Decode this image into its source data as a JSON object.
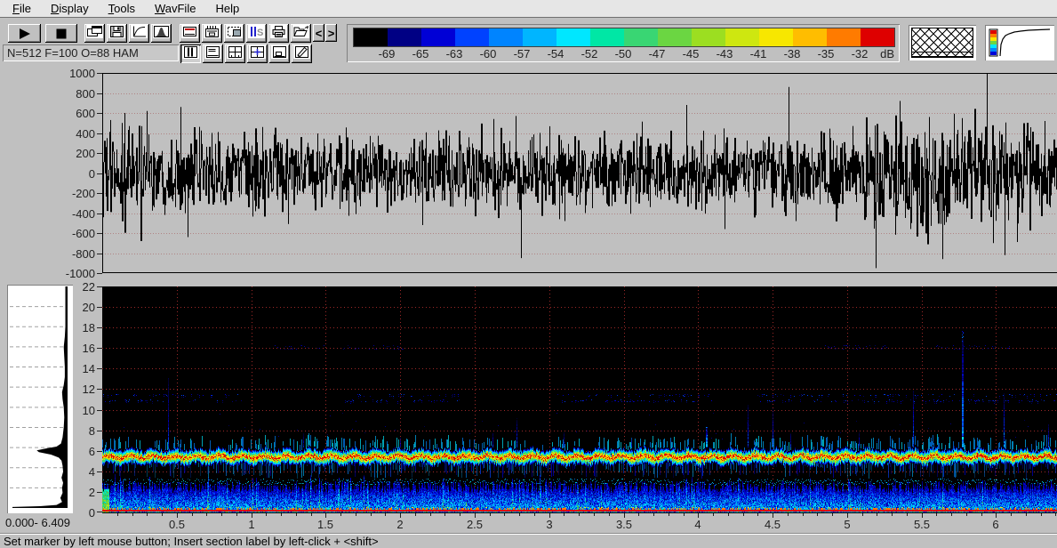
{
  "menu": {
    "items": [
      {
        "label": "File",
        "underline": 0
      },
      {
        "label": "Display",
        "underline": 0
      },
      {
        "label": "Tools",
        "underline": 0
      },
      {
        "label": "WavFile",
        "underline": 0
      },
      {
        "label": "Help",
        "underline": -1
      }
    ]
  },
  "toolbar": {
    "play_glyph": "▶",
    "stop_glyph": "■",
    "info_field": "N=512 F=100 O=88 HAM",
    "row1_group1": [
      "cascade-windows",
      "save",
      "amplitude-curve",
      "window-function"
    ],
    "row1_group2": [
      "spectrogram-display",
      "marker-display",
      "zoom-selection",
      "sections",
      "print",
      "open-file"
    ],
    "nav": [
      {
        "name": "previous",
        "glyph": "<"
      },
      {
        "name": "next",
        "glyph": ">"
      }
    ],
    "row2": [
      "view-columns",
      "view-rows",
      "view-quad",
      "view-quad-cursor",
      "view-inset",
      "edit-labels"
    ],
    "row2_pressed_index": 0
  },
  "color_scale": {
    "segments": [
      "#000000",
      "#000084",
      "#0000d6",
      "#0042ff",
      "#0084ff",
      "#00b5ff",
      "#00e7ff",
      "#00e7a5",
      "#39d673",
      "#6bd642",
      "#9cde21",
      "#cee710",
      "#f7e700",
      "#ffbd00",
      "#ff7b00",
      "#de0000"
    ],
    "labels": [
      "-69",
      "-65",
      "-63",
      "-60",
      "-57",
      "-54",
      "-52",
      "-50",
      "-47",
      "-45",
      "-43",
      "-41",
      "-38",
      "-35",
      "-32"
    ],
    "unit": "dB"
  },
  "waveform": {
    "ylim": [
      -1000,
      1000
    ],
    "yticks": [
      1000,
      800,
      600,
      400,
      200,
      0,
      -200,
      -400,
      -600,
      -800,
      -1000
    ],
    "grid_color": "#b08484",
    "seed": 1234,
    "noise_scale": 650,
    "spikes": [
      [
        50,
        620
      ],
      [
        88,
        660
      ],
      [
        96,
        -640
      ],
      [
        360,
        -520
      ],
      [
        440,
        540
      ],
      [
        465,
        570
      ],
      [
        471,
        -850
      ],
      [
        520,
        -480
      ],
      [
        657,
        680
      ],
      [
        700,
        -560
      ],
      [
        772,
        860
      ],
      [
        870,
        -950
      ],
      [
        930,
        560
      ],
      [
        945,
        -860
      ],
      [
        995,
        1000
      ],
      [
        1002,
        -700
      ],
      [
        1015,
        -820
      ],
      [
        1060,
        520
      ]
    ],
    "boost_regions": [
      [
        0,
        45,
        1.55
      ],
      [
        855,
        1045,
        1.4
      ]
    ]
  },
  "spectrogram": {
    "flim": [
      0,
      22
    ],
    "yticks": [
      22,
      20,
      18,
      16,
      14,
      12,
      10,
      8,
      6,
      4,
      2,
      0
    ],
    "tlim": [
      0,
      6.409
    ],
    "xticks": [
      0.5,
      1,
      1.5,
      2,
      2.5,
      3,
      3.5,
      4,
      4.5,
      5,
      5.5,
      6
    ],
    "grid_color": "#9c2828",
    "seed": 99,
    "main_band": {
      "center": 5.45,
      "fringe": 0.55
    },
    "band_3k": [
      2.7,
      3.3
    ],
    "band_11k": {
      "range": [
        10.6,
        11.9
      ],
      "segments": [
        [
          0,
          0.95
        ],
        [
          1.6,
          2.4
        ],
        [
          3.05,
          4.1
        ],
        [
          4.4,
          6.409
        ]
      ]
    },
    "band_16k": {
      "range": [
        15.8,
        16.4
      ],
      "segments": [
        [
          1.15,
          1.5
        ],
        [
          1.62,
          2.02
        ],
        [
          4.85,
          5.3
        ],
        [
          5.6,
          6.1
        ]
      ]
    },
    "events": [
      [
        0.44,
        14,
        0.5
      ],
      [
        1.35,
        8,
        0.4
      ],
      [
        2.0,
        7.5,
        0.4
      ],
      [
        2.62,
        8,
        0.5
      ],
      [
        2.78,
        9.5,
        0.6
      ],
      [
        3.1,
        8,
        0.5
      ],
      [
        3.55,
        7.5,
        0.4
      ],
      [
        4.05,
        8.5,
        0.9
      ],
      [
        4.33,
        11,
        0.6
      ],
      [
        4.5,
        10.5,
        0.6
      ],
      [
        4.62,
        8,
        0.5
      ],
      [
        5.08,
        8,
        0.5
      ],
      [
        5.44,
        12.5,
        0.7
      ],
      [
        5.77,
        18,
        1.0
      ],
      [
        6.05,
        12,
        0.8
      ],
      [
        6.35,
        9,
        0.6
      ]
    ]
  },
  "spectrum_panel": {
    "range_label": "0.000- 6.409",
    "profile": [
      [
        0,
        1.0
      ],
      [
        0.1,
        1.0
      ],
      [
        0.18,
        0.5
      ],
      [
        0.3,
        0.2
      ],
      [
        0.6,
        0.1
      ],
      [
        1.0,
        0.13
      ],
      [
        1.5,
        0.09
      ],
      [
        2.0,
        0.1
      ],
      [
        2.5,
        0.08
      ],
      [
        3.0,
        0.11
      ],
      [
        3.6,
        0.08
      ],
      [
        4.2,
        0.09
      ],
      [
        4.7,
        0.11
      ],
      [
        5.0,
        0.16
      ],
      [
        5.3,
        0.3
      ],
      [
        5.55,
        0.52
      ],
      [
        5.72,
        0.56
      ],
      [
        5.9,
        0.4
      ],
      [
        6.1,
        0.2
      ],
      [
        6.4,
        0.12
      ],
      [
        7.0,
        0.09
      ],
      [
        8.0,
        0.07
      ],
      [
        9.0,
        0.06
      ],
      [
        10.0,
        0.07
      ],
      [
        10.8,
        0.09
      ],
      [
        11.5,
        0.1
      ],
      [
        12.2,
        0.07
      ],
      [
        13.0,
        0.05
      ],
      [
        14.0,
        0.05
      ],
      [
        15.0,
        0.06
      ],
      [
        16.0,
        0.07
      ],
      [
        17.0,
        0.05
      ],
      [
        18.0,
        0.04
      ],
      [
        19.0,
        0.04
      ],
      [
        20.0,
        0.04
      ],
      [
        21.0,
        0.04
      ],
      [
        22.0,
        0.04
      ]
    ]
  },
  "status_bar": {
    "text": "Set marker by left mouse button; Insert section label by left-click + <shift>"
  }
}
